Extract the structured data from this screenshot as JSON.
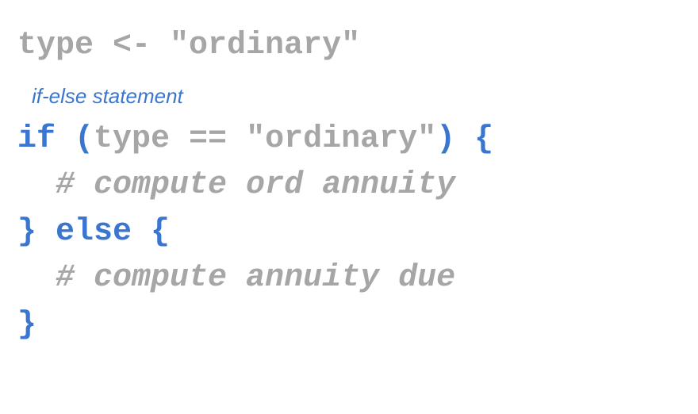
{
  "annotation": "if-else statement",
  "code": {
    "line1": {
      "text": "type <- \"ordinary\""
    },
    "line2": {
      "kw_if": "if",
      "open_paren": " (",
      "condition": "type == \"ordinary\"",
      "close_paren_brace": ") {"
    },
    "line3": {
      "indent": "  ",
      "comment": "# compute ord annuity"
    },
    "line4": {
      "close_else_open": "} else {"
    },
    "line5": {
      "indent": "  ",
      "comment": "# compute annuity due"
    },
    "line6": {
      "close_brace": "}"
    }
  },
  "colors": {
    "keyword_blue": "#3a76d0",
    "code_grey": "#a6a6a6",
    "background": "#ffffff"
  }
}
